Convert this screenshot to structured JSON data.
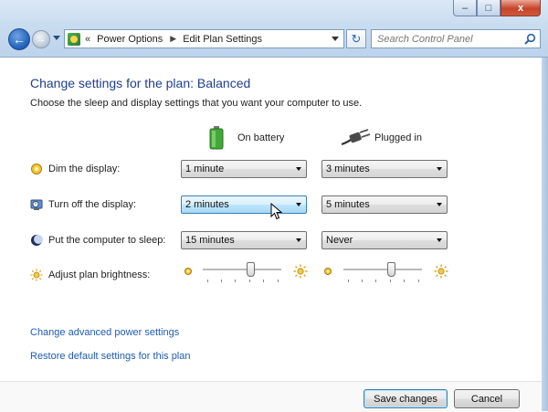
{
  "window": {
    "minimize_glyph": "–",
    "maximize_glyph": "□",
    "close_glyph": "x"
  },
  "nav": {
    "back_glyph": "←",
    "forward_glyph": "→",
    "address_chevron": "«",
    "breadcrumb": [
      "Power Options",
      "Edit Plan Settings"
    ],
    "breadcrumb_separator": "▶",
    "refresh_glyph": "↻",
    "search_placeholder": "Search Control Panel"
  },
  "content": {
    "title": "Change settings for the plan: Balanced",
    "description": "Choose the sleep and display settings that you want your computer to use.",
    "columns": {
      "battery": "On battery",
      "plugged": "Plugged in"
    },
    "settings": [
      {
        "icon": "dim-display-icon",
        "label": "Dim the display:",
        "battery": "1 minute",
        "plugged": "3 minutes"
      },
      {
        "icon": "turn-off-display-icon",
        "label": "Turn off the display:",
        "battery": "2 minutes",
        "plugged": "5 minutes"
      },
      {
        "icon": "sleep-moon-icon",
        "label": "Put the computer to sleep:",
        "battery": "15 minutes",
        "plugged": "Never"
      }
    ],
    "brightness": {
      "label": "Adjust plan brightness:",
      "battery_level": 0.62,
      "plugged_level": 0.62
    },
    "links": {
      "advanced": "Change advanced power settings",
      "restore": "Restore default settings for this plan"
    }
  },
  "footer": {
    "save": "Save changes",
    "cancel": "Cancel"
  },
  "colors": {
    "title_blue": "#1e3f8e",
    "link_blue": "#1f5bb5",
    "highlight": "#bee6fd"
  }
}
